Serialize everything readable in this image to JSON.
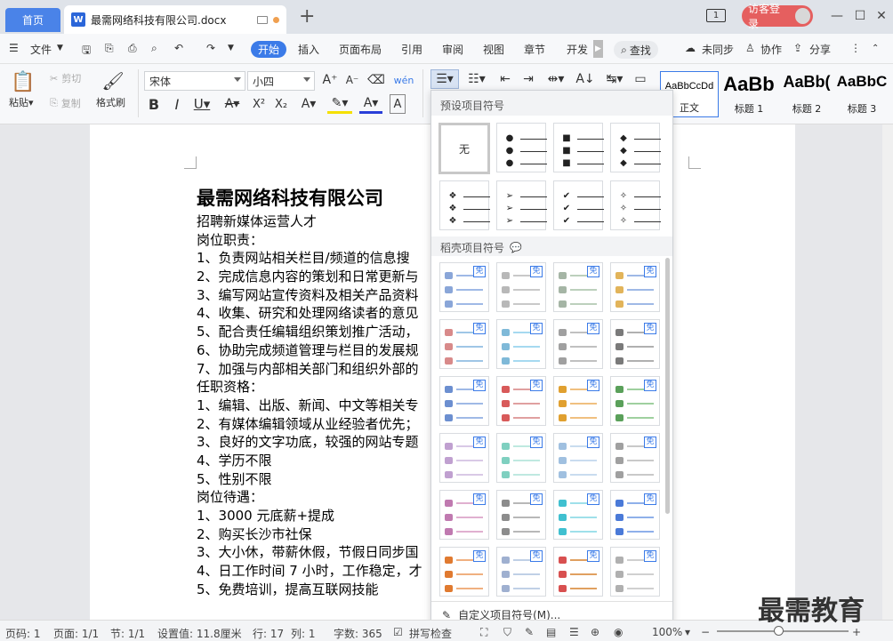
{
  "tabs": {
    "home": "首页",
    "doc": "最需网络科技有限公司.docx"
  },
  "window": {
    "badge": "1",
    "login": "访客登录"
  },
  "menu": {
    "file": "文件",
    "items": [
      "开始",
      "插入",
      "页面布局",
      "引用",
      "审阅",
      "视图",
      "章节",
      "开发"
    ],
    "search": "查找",
    "sync": "未同步",
    "collab": "协作",
    "share": "分享"
  },
  "toolbar": {
    "paste": "粘贴",
    "cut": "剪切",
    "copy": "复制",
    "format_painter": "格式刷",
    "font": "宋体",
    "size": "小四",
    "styles": [
      {
        "preview": "AaBbCcDd",
        "label": "正文"
      },
      {
        "preview": "AaBb",
        "label": "标题 1"
      },
      {
        "preview": "AaBb(",
        "label": "标题 2"
      },
      {
        "preview": "AaBbC",
        "label": "标题 3"
      }
    ]
  },
  "document": {
    "title": "最需网络科技有限公司",
    "lines": [
      "招聘新媒体运营人才",
      "岗位职责：",
      "1、负责网站相关栏目/频道的信息搜",
      "2、完成信息内容的策划和日常更新与",
      "3、编写网站宣传资料及相关产品资料",
      "4、收集、研究和处理网络读者的意见",
      "5、配合责任编辑组织策划推广活动，",
      "6、协助完成频道管理与栏目的发展规",
      "7、加强与内部相关部门和组织外部的",
      "任职资格：",
      "1、编辑、出版、新闻、中文等相关专",
      "2、有媒体编辑领域从业经验者优先；",
      "3、良好的文字功底，较强的网站专题",
      "4、学历不限",
      "5、性别不限",
      "岗位待遇：",
      "1、3000 元底薪+提成",
      "2、购买长沙市社保",
      "3、大小休，带薪休假，节假日同步国",
      "4、日工作时间 7 小时，工作稳定，才",
      "5、免费培训，提高互联网技能"
    ]
  },
  "bullet_panel": {
    "preset_header": "预设项目符号",
    "none_label": "无",
    "preset_markers": [
      "●",
      "■",
      "◆",
      "❖",
      "➢",
      "✔",
      "✧"
    ],
    "wps_header": "稻壳项目符号",
    "free_label": "免",
    "custom": "自定义项目符号(M)..."
  },
  "status": {
    "page_num": "页码: 1",
    "pages": "页面: 1/1",
    "section": "节: 1/1",
    "setting": "设置值: 11.8厘米",
    "row": "行: 17",
    "col": "列: 1",
    "words": "字数: 365",
    "spell": "拼写检查",
    "zoom": "100%"
  },
  "watermark": "最需教育",
  "colors": {
    "accent": "#3b7be8",
    "login": "#e55f5f",
    "home_tab": "#4a83e8"
  }
}
